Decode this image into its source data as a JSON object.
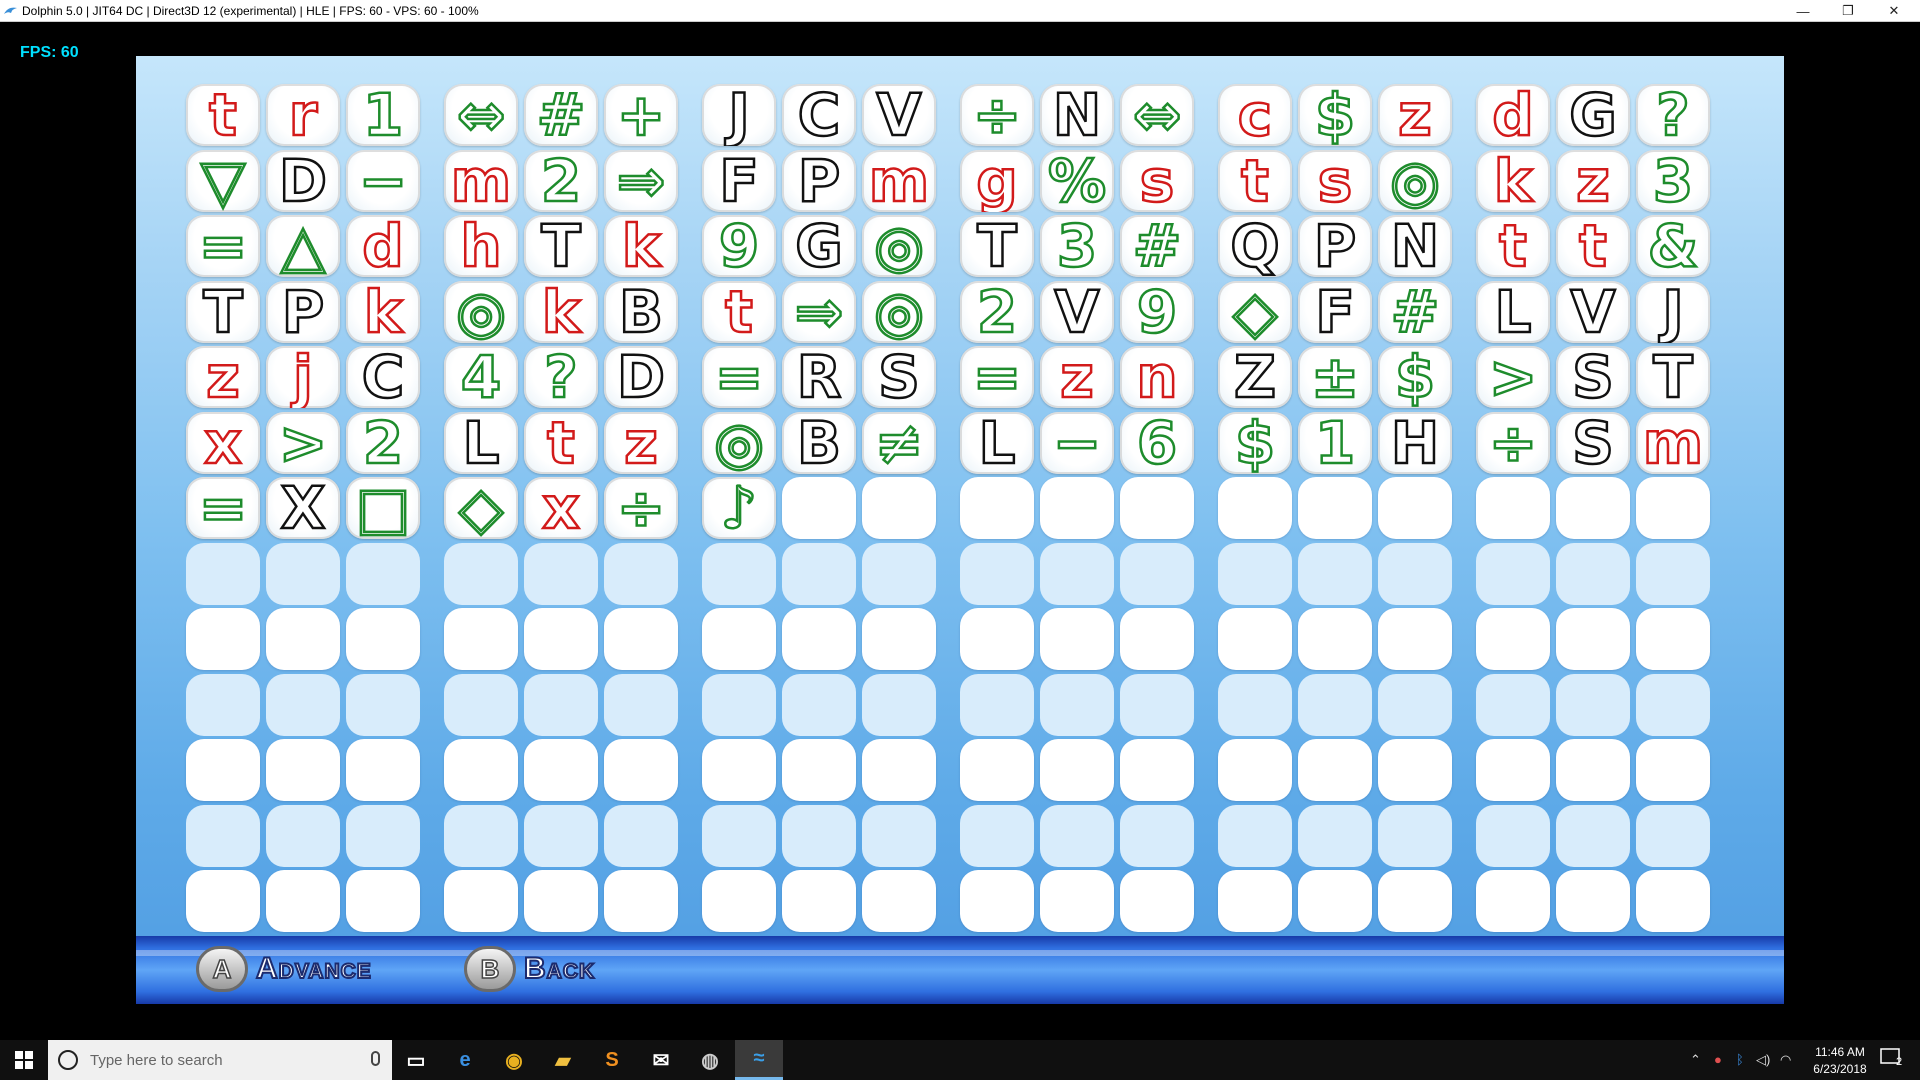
{
  "window": {
    "title": "Dolphin 5.0 | JIT64 DC | Direct3D 12 (experimental) | HLE | FPS: 60 - VPS: 60 - 100%",
    "minimize_glyph": "—",
    "maximize_glyph": "❐",
    "close_glyph": "✕"
  },
  "overlay": {
    "fps": "FPS: 60"
  },
  "colors": {
    "red": "#d21a1a",
    "green": "#1e8c2c",
    "black": "#111111",
    "accent_fps": "#00e0ff"
  },
  "grid": {
    "rows": [
      [
        [
          "t",
          "red"
        ],
        [
          "r",
          "red"
        ],
        [
          "1",
          "green"
        ],
        [
          "⇔",
          "green"
        ],
        [
          "#",
          "green"
        ],
        [
          "+",
          "green"
        ],
        [
          "J",
          "black"
        ],
        [
          "C",
          "black"
        ],
        [
          "V",
          "black"
        ],
        [
          "÷",
          "green"
        ],
        [
          "N",
          "black"
        ],
        [
          "⇔",
          "green"
        ],
        [
          "c",
          "red"
        ],
        [
          "$",
          "green"
        ],
        [
          "z",
          "red"
        ],
        [
          "d",
          "red"
        ],
        [
          "G",
          "black"
        ],
        [
          "?",
          "green"
        ]
      ],
      [
        [
          "▽",
          "green"
        ],
        [
          "D",
          "black"
        ],
        [
          "−",
          "green"
        ],
        [
          "m",
          "red"
        ],
        [
          "2",
          "green"
        ],
        [
          "⇒",
          "green"
        ],
        [
          "F",
          "black"
        ],
        [
          "P",
          "black"
        ],
        [
          "m",
          "red"
        ],
        [
          "g",
          "red"
        ],
        [
          "%",
          "green"
        ],
        [
          "s",
          "red"
        ],
        [
          "t",
          "red"
        ],
        [
          "s",
          "red"
        ],
        [
          "◎",
          "green"
        ],
        [
          "k",
          "red"
        ],
        [
          "z",
          "red"
        ],
        [
          "3",
          "green"
        ]
      ],
      [
        [
          "=",
          "green"
        ],
        [
          "△",
          "green"
        ],
        [
          "d",
          "red"
        ],
        [
          "h",
          "red"
        ],
        [
          "T",
          "black"
        ],
        [
          "k",
          "red"
        ],
        [
          "9",
          "green"
        ],
        [
          "G",
          "black"
        ],
        [
          "◎",
          "green"
        ],
        [
          "T",
          "black"
        ],
        [
          "3",
          "green"
        ],
        [
          "#",
          "green"
        ],
        [
          "Q",
          "black"
        ],
        [
          "P",
          "black"
        ],
        [
          "N",
          "black"
        ],
        [
          "t",
          "red"
        ],
        [
          "t",
          "red"
        ],
        [
          "&",
          "green"
        ]
      ],
      [
        [
          "T",
          "black"
        ],
        [
          "P",
          "black"
        ],
        [
          "k",
          "red"
        ],
        [
          "◎",
          "green"
        ],
        [
          "k",
          "red"
        ],
        [
          "B",
          "black"
        ],
        [
          "t",
          "red"
        ],
        [
          "⇒",
          "green"
        ],
        [
          "◎",
          "green"
        ],
        [
          "2",
          "green"
        ],
        [
          "V",
          "black"
        ],
        [
          "9",
          "green"
        ],
        [
          "◇",
          "green"
        ],
        [
          "F",
          "black"
        ],
        [
          "#",
          "green"
        ],
        [
          "L",
          "black"
        ],
        [
          "V",
          "black"
        ],
        [
          "J",
          "black"
        ]
      ],
      [
        [
          "z",
          "red"
        ],
        [
          "j",
          "red"
        ],
        [
          "C",
          "black"
        ],
        [
          "4",
          "green"
        ],
        [
          "?",
          "green"
        ],
        [
          "D",
          "black"
        ],
        [
          "=",
          "green"
        ],
        [
          "R",
          "black"
        ],
        [
          "S",
          "black"
        ],
        [
          "=",
          "green"
        ],
        [
          "z",
          "red"
        ],
        [
          "n",
          "red"
        ],
        [
          "Z",
          "black"
        ],
        [
          "±",
          "green"
        ],
        [
          "$",
          "green"
        ],
        [
          ">",
          "green"
        ],
        [
          "S",
          "black"
        ],
        [
          "T",
          "black"
        ]
      ],
      [
        [
          "x",
          "red"
        ],
        [
          ">",
          "green"
        ],
        [
          "2",
          "green"
        ],
        [
          "L",
          "black"
        ],
        [
          "t",
          "red"
        ],
        [
          "z",
          "red"
        ],
        [
          "◎",
          "green"
        ],
        [
          "B",
          "black"
        ],
        [
          "≠",
          "green"
        ],
        [
          "L",
          "black"
        ],
        [
          "−",
          "green"
        ],
        [
          "6",
          "green"
        ],
        [
          "$",
          "green"
        ],
        [
          "1",
          "green"
        ],
        [
          "H",
          "black"
        ],
        [
          "÷",
          "green"
        ],
        [
          "S",
          "black"
        ],
        [
          "m",
          "red"
        ]
      ],
      [
        [
          "=",
          "green"
        ],
        [
          "X",
          "black"
        ],
        [
          "□",
          "green"
        ],
        [
          "◇",
          "green"
        ],
        [
          "x",
          "red"
        ],
        [
          "÷",
          "green"
        ],
        [
          "♪",
          "green"
        ],
        null,
        null,
        null,
        null,
        null,
        null,
        null,
        null,
        null,
        null,
        null
      ]
    ],
    "empty_rows": 7
  },
  "button_bar": {
    "advance": {
      "key": "A",
      "label": "Advance"
    },
    "back": {
      "key": "B",
      "label": "Back"
    }
  },
  "taskbar": {
    "search_placeholder": "Type here to search",
    "icons": [
      "task-view-icon",
      "edge-icon",
      "chrome-icon",
      "file-explorer-icon",
      "sublime-text-icon",
      "mail-icon",
      "obs-icon",
      "dolphin-icon"
    ],
    "clock_time": "11:46 AM",
    "clock_date": "6/23/2018",
    "notification_count": "2"
  }
}
